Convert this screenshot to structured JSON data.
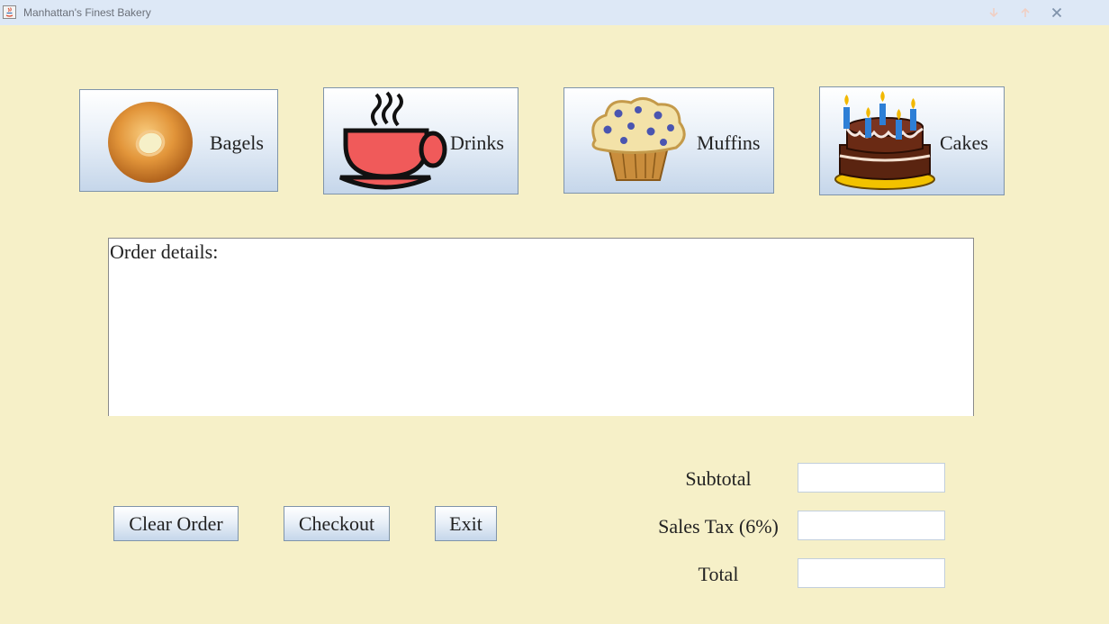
{
  "window": {
    "title": "Manhattan's Finest Bakery",
    "icons": [
      "java-app-icon",
      "minimize-icon",
      "maximize-icon",
      "close-icon"
    ]
  },
  "categories": [
    {
      "label": "Bagels",
      "icon": "bagel-icon"
    },
    {
      "label": "Drinks",
      "icon": "coffee-cup-icon"
    },
    {
      "label": "Muffins",
      "icon": "muffin-icon"
    },
    {
      "label": "Cakes",
      "icon": "cake-icon"
    }
  ],
  "order": {
    "text": "Order details:"
  },
  "actions": {
    "clear_label": "Clear Order",
    "checkout_label": "Checkout",
    "exit_label": "Exit"
  },
  "summary": {
    "subtotal_label": "Subtotal",
    "tax_label": "Sales Tax (6%)",
    "total_label": "Total",
    "subtotal_value": "",
    "tax_value": "",
    "total_value": ""
  },
  "colors": {
    "background": "#f6f0c8",
    "titlebar": "#dde8f6",
    "cup": "#f05a5a"
  }
}
